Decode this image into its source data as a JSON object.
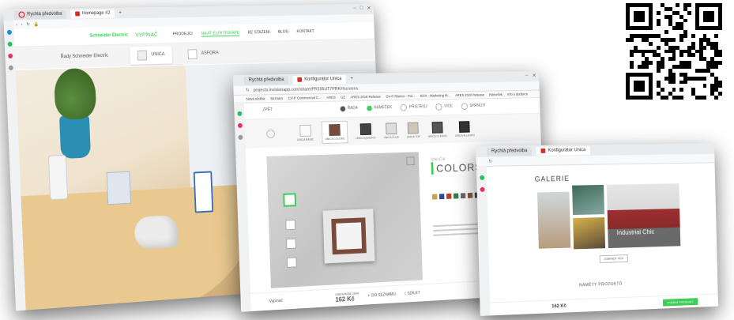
{
  "browser1": {
    "tabs": [
      "Rychlá předvolba",
      "Homepage #2"
    ],
    "brand": "Schneider Electric",
    "wizard_logo": "VYPÍNAČ",
    "nav": [
      "PRODEJCI",
      "NAJÍT ELEKTRIKÁŘE",
      "KE STAŽENÍ",
      "BLOG",
      "KONTAKT"
    ],
    "series_label": "Řady Schneider Electric",
    "series_tabs": [
      "UNICA",
      "ASFORA"
    ],
    "accent": "#3dcd58"
  },
  "browser2": {
    "tabs": [
      "Rychlá předvolba",
      "Konfigurátor Unica"
    ],
    "url": "projects.invisionapp.com/share/PR156UT7PRK#/screens",
    "bookmarks": [
      "Nová složka",
      "Seznam",
      "CV-P Commercial C...",
      "ARES",
      "ÚZ",
      "ARES 2019 Release",
      "OV-P Rámce - Pol...",
      "BOX - Marketing M...",
      "ARES 2020 Release",
      "Rámeček",
      "Info o dodávce"
    ],
    "back_label": "ZPĚT",
    "steps": [
      "ŘADA",
      "RÁMEČEK",
      "PŘÍSTROJ",
      "VÍCE",
      "SHRNUTÍ"
    ],
    "frame_options": [
      "UNICA BASIC",
      "UNICA COLORS",
      "UNICA QUADRO",
      "UNICA PLUS",
      "UNICA TOP",
      "UNICA CLASSIC",
      "UNICA ALLEGRO"
    ],
    "series_small": "UNICA",
    "series_big": "COLORS",
    "price_label": "ORIENTAČNÍ CENA",
    "price": "162 Kč",
    "action_save": "DO SEZNAMU",
    "action_share": "SDÍLET",
    "footer_logo": "Vypínač"
  },
  "browser3": {
    "tabs": [
      "Rychlá předvolba",
      "Konfigurátor Unica"
    ],
    "gallery_title": "GALERIE",
    "gallery_caption": "Industrial Chic",
    "more_button": "ZOBRAZIT VÍCE",
    "section_title": "NÁMĚTY PRODUKTŮ",
    "price": "162 Kč",
    "cta_button": "VYBRAT PRODUKT"
  },
  "colors": {
    "frame_brown": "#7a4a3a",
    "swatches": [
      "#c9a24b",
      "#2e4b8b",
      "#c23a2a",
      "#3a7a4a",
      "#6a6a6a",
      "#8a5a3a",
      "#444444",
      "#b07a4a"
    ]
  }
}
